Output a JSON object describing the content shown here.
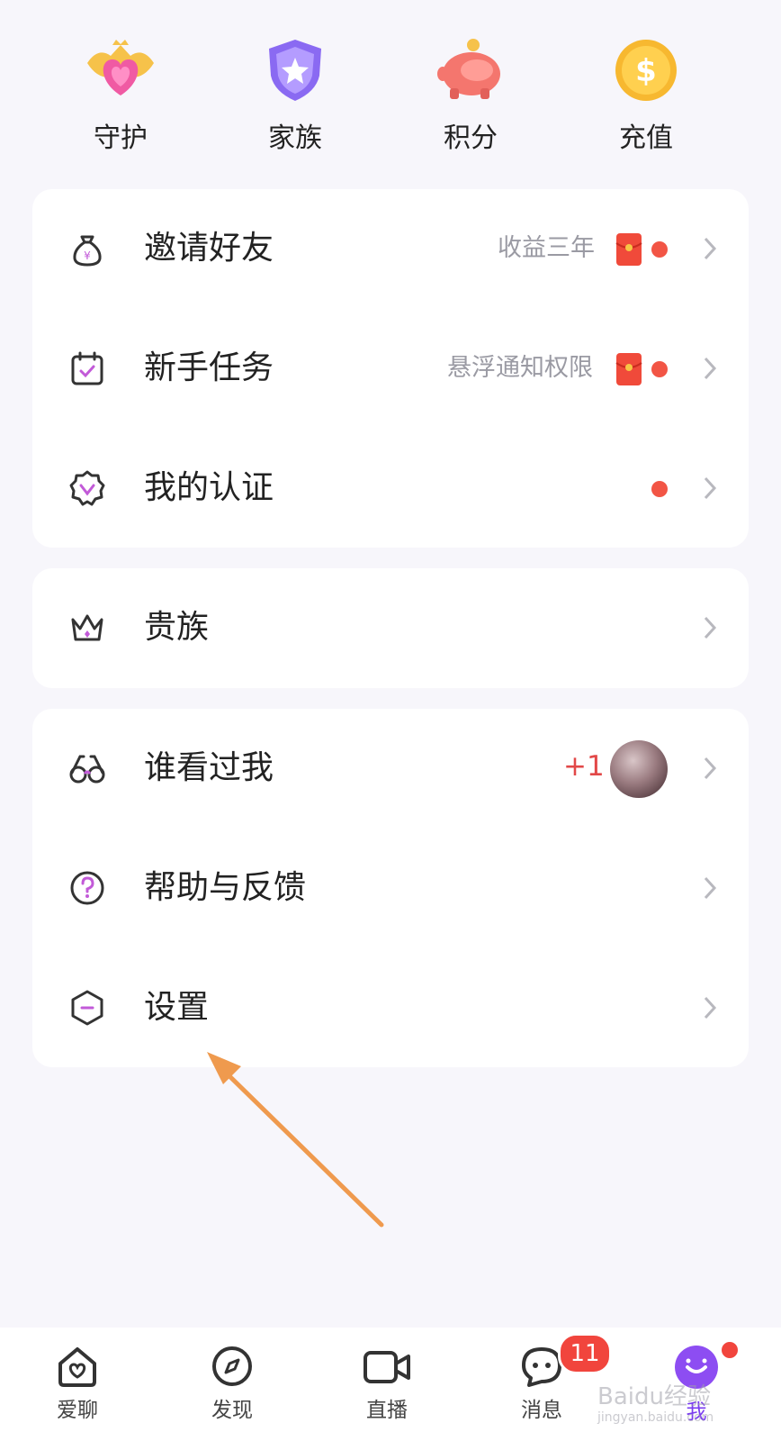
{
  "shortcuts": [
    {
      "label": "守护",
      "icon": "guard-heart-icon"
    },
    {
      "label": "家族",
      "icon": "family-shield-icon"
    },
    {
      "label": "积分",
      "icon": "piggy-bank-icon"
    },
    {
      "label": "充值",
      "icon": "coin-recharge-icon"
    }
  ],
  "group1": {
    "invite": {
      "label": "邀请好友",
      "hint": "收益三年",
      "icon": "money-bag-icon"
    },
    "newbie": {
      "label": "新手任务",
      "hint": "悬浮通知权限",
      "icon": "calendar-check-icon"
    },
    "verify": {
      "label": "我的认证",
      "icon": "verified-badge-icon"
    }
  },
  "group2": {
    "noble": {
      "label": "贵族",
      "icon": "crown-icon"
    }
  },
  "group3": {
    "visitors": {
      "label": "谁看过我",
      "count": "+1",
      "icon": "glasses-icon"
    },
    "help": {
      "label": "帮助与反馈",
      "icon": "help-circle-icon"
    },
    "settings": {
      "label": "设置",
      "icon": "settings-hexagon-icon"
    }
  },
  "tabbar": {
    "chat": "爱聊",
    "discover": "发现",
    "live": "直播",
    "messages": "消息",
    "messages_badge": "11",
    "me": "我"
  },
  "watermark": {
    "main": "Baidu经验",
    "sub": "jingyan.baidu.com"
  },
  "colors": {
    "accent": "#7a3cf0",
    "red_dot": "#f25545",
    "page_bg": "#f7f6fb",
    "annotation_arrow": "#ef9a4e"
  }
}
